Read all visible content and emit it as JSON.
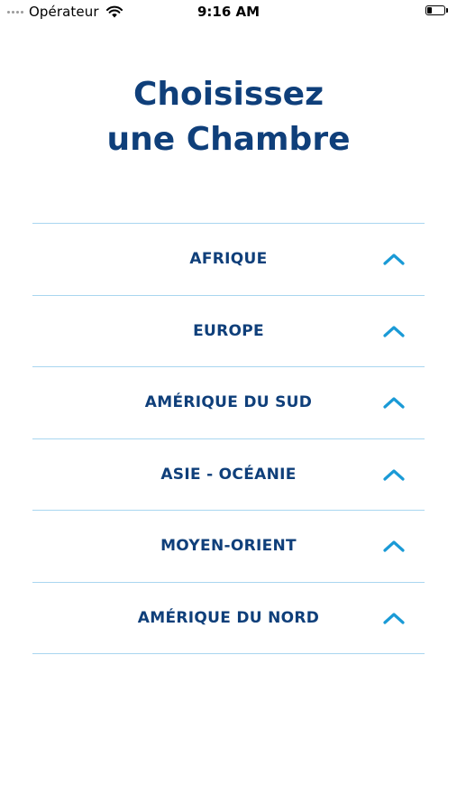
{
  "status_bar": {
    "carrier": "Opérateur",
    "time": "9:16 AM",
    "battery_level": 0.25
  },
  "title": {
    "line1": "Choisissez",
    "line2": "une Chambre"
  },
  "regions": [
    {
      "label": "AFRIQUE"
    },
    {
      "label": "EUROPE"
    },
    {
      "label": "AMÉRIQUE DU SUD"
    },
    {
      "label": "ASIE - OCÉANIE"
    },
    {
      "label": "MOYEN-ORIENT"
    },
    {
      "label": "AMÉRIQUE DU NORD"
    }
  ],
  "colors": {
    "title": "#0f3f7a",
    "label": "#0f3f7a",
    "divider": "#a9d6f0",
    "chevron": "#1a9ad6"
  },
  "icons": {
    "chevron": "chevron-up-icon",
    "wifi": "wifi-icon",
    "battery": "battery-icon",
    "signal": "signal-dots-icon"
  }
}
